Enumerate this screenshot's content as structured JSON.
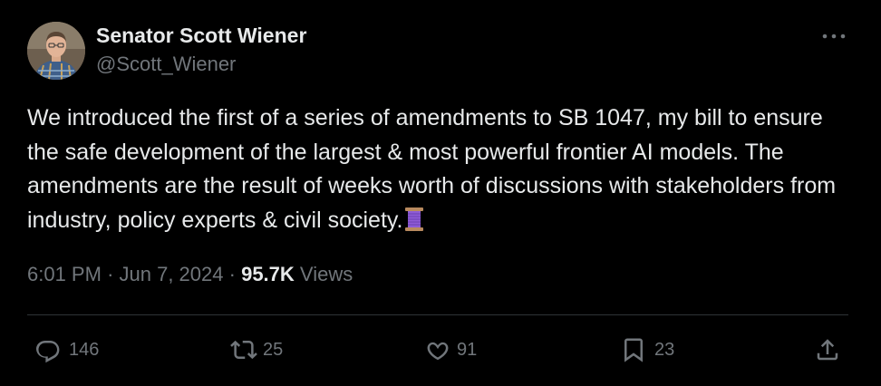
{
  "author": {
    "display_name": "Senator Scott Wiener",
    "handle": "@Scott_Wiener"
  },
  "tweet": {
    "text": "We introduced the first of a series of amendments to SB 1047, my bill to ensure the safe development of the largest & most powerful frontier AI models. The amendments are the result of weeks worth of discussions with stakeholders from industry, policy experts & civil society.",
    "emoji": "thread-spool-icon"
  },
  "meta": {
    "time": "6:01 PM",
    "date": "Jun 7, 2024",
    "view_count": "95.7K",
    "views_label": "Views",
    "separator": "·"
  },
  "actions": {
    "replies": "146",
    "reposts": "25",
    "likes": "91",
    "bookmarks": "23"
  },
  "icons": {
    "more": "more-horizontal-icon",
    "reply": "reply-icon",
    "repost": "repost-icon",
    "like": "heart-icon",
    "bookmark": "bookmark-icon",
    "share": "share-icon"
  },
  "colors": {
    "background": "#000000",
    "text": "#e7e9ea",
    "secondary": "#71767b",
    "divider": "#2f3336"
  }
}
